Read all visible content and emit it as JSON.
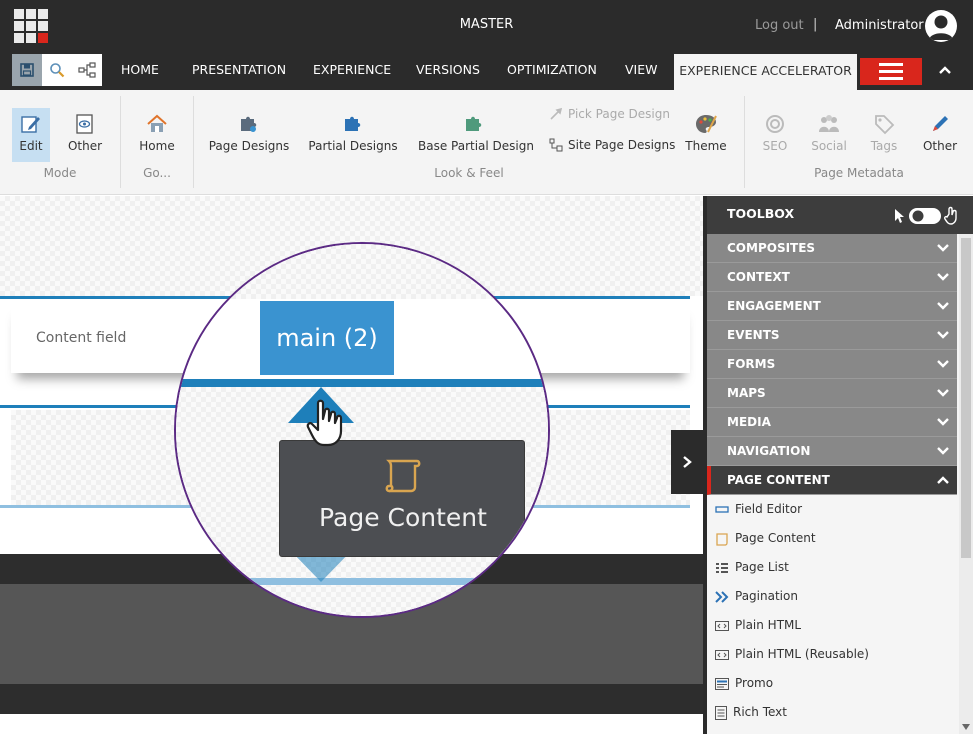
{
  "topbar": {
    "title": "MASTER",
    "logout": "Log out",
    "separator": "|",
    "user": "Administrator"
  },
  "tabs": [
    "HOME",
    "PRESENTATION",
    "EXPERIENCE",
    "VERSIONS",
    "OPTIMIZATION",
    "VIEW",
    "EXPERIENCE ACCELERATOR"
  ],
  "ribbon": {
    "mode": {
      "edit": "Edit",
      "other": "Other",
      "label": "Mode"
    },
    "go": {
      "home": "Home",
      "label": "Go..."
    },
    "look": {
      "page_designs": "Page Designs",
      "partial_designs": "Partial Designs",
      "base_partial": "Base Partial Design",
      "pick_page_design": "Pick Page Design",
      "site_page_designs": "Site Page Designs",
      "theme": "Theme",
      "label": "Look & Feel"
    },
    "meta": {
      "seo": "SEO",
      "social": "Social",
      "tags": "Tags",
      "other": "Other",
      "label": "Page Metadata"
    }
  },
  "canvas": {
    "content_field": "Content field",
    "placeholder": "main (2)",
    "tooltip": "Page Content"
  },
  "toolbox": {
    "title": "TOOLBOX",
    "categories": [
      "COMPOSITES",
      "CONTEXT",
      "ENGAGEMENT",
      "EVENTS",
      "FORMS",
      "MAPS",
      "MEDIA",
      "NAVIGATION"
    ],
    "open_category": "PAGE CONTENT",
    "components": [
      "Field Editor",
      "Page Content",
      "Page List",
      "Pagination",
      "Plain HTML",
      "Plain HTML (Reusable)",
      "Promo",
      "Rich Text"
    ]
  },
  "colors": {
    "accent": "#d9261c",
    "blue": "#1e7fba",
    "placeholder": "#3a93d0",
    "magnifier_border": "#5b2a84"
  }
}
